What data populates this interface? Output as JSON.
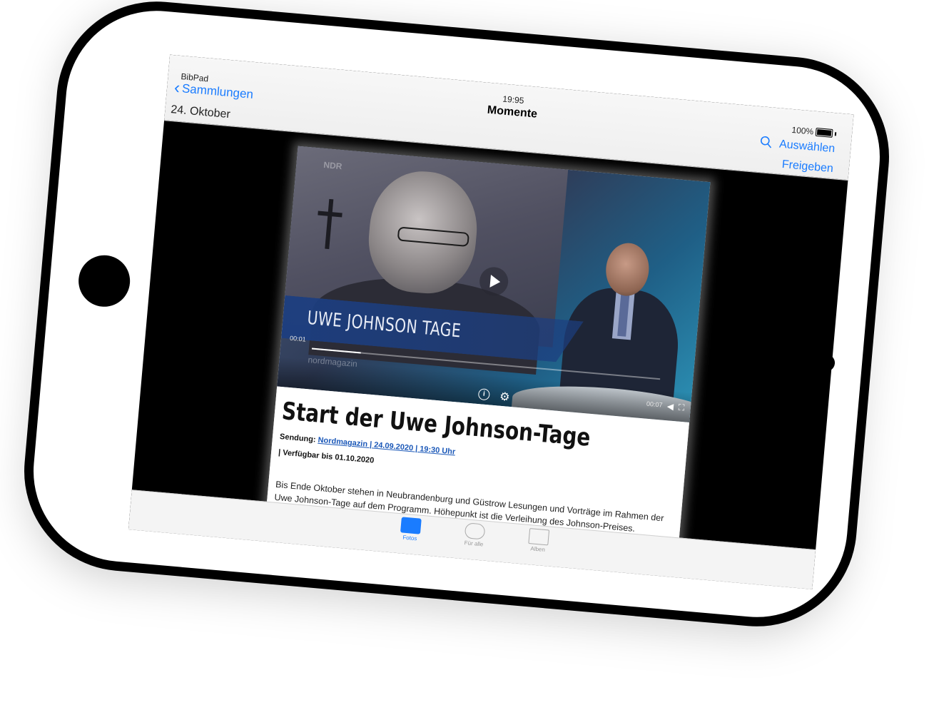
{
  "status_bar": {
    "carrier": "BibPad",
    "time": "19:95",
    "battery": "100%"
  },
  "nav": {
    "back_label": "Sammlungen",
    "date": "24. Oktober",
    "title": "Momente",
    "select_label": "Auswählen",
    "share_label": "Freigeben"
  },
  "video": {
    "broadcaster_mark": "NDR",
    "banner_text": "UWE JOHNSON TAGE",
    "channel_logo": "nordmagazin",
    "time_elapsed": "00:01",
    "time_total": "00:07",
    "progress": 0.14
  },
  "article": {
    "title": "Start der Uwe Johnson-Tage",
    "sendung_label": "Sendung:",
    "sendung_link": "Nordmagazin | 24.09.2020 | 19:30 Uhr",
    "availability": "| Verfügbar bis 01.10.2020",
    "body": "Bis Ende Oktober stehen in Neubrandenburg und Güstrow Lesungen und Vorträge im Rahmen der Uwe Johnson-Tage auf dem Programm. Höhepunkt ist die Verleihung des Johnson-Preises."
  },
  "tabbar": {
    "items": [
      {
        "label": "Fotos",
        "icon": "photos-icon",
        "active": true
      },
      {
        "label": "Für alle",
        "icon": "cloud-icon",
        "active": false
      },
      {
        "label": "Alben",
        "icon": "album-icon",
        "active": false
      }
    ]
  },
  "colors": {
    "ios_blue": "#1a7cff",
    "bezel": "#000000",
    "banner_blue": "#1c3e80"
  }
}
